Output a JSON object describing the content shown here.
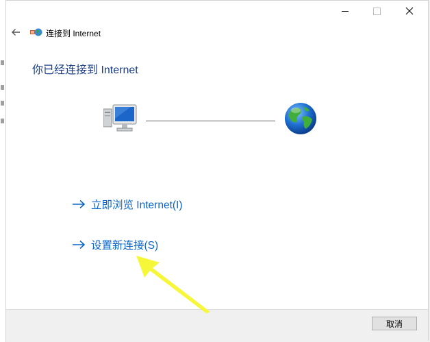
{
  "window": {
    "title": "连接到 Internet",
    "controls": {
      "minimize": "minimize",
      "maximize": "maximize",
      "close": "close"
    }
  },
  "main": {
    "heading": "你已经连接到 Internet",
    "status_graphic": {
      "left_icon": "computer-icon",
      "right_icon": "globe-icon",
      "connected": true
    }
  },
  "tasks": [
    {
      "label": "立即浏览 Internet(I)",
      "icon": "arrow-right-icon"
    },
    {
      "label": "设置新连接(S)",
      "icon": "arrow-right-icon"
    }
  ],
  "footer": {
    "cancel_label": "取消"
  },
  "annotation": {
    "type": "yellow-arrow",
    "target": "设置新连接(S)",
    "color": "#f7f73a"
  },
  "colors": {
    "heading": "#1b3e8a",
    "link": "#0a64c8",
    "footer_bg": "#f0f0f0"
  }
}
